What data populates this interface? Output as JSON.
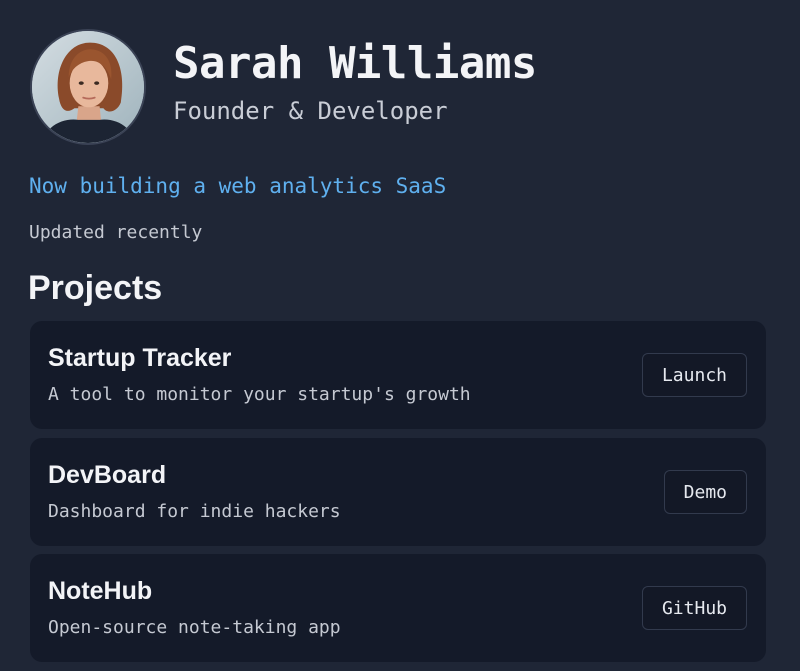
{
  "profile": {
    "name": "Sarah Williams",
    "role": "Founder & Developer",
    "avatar_icon": "profile-photo"
  },
  "status": {
    "text": "Now building a web analytics SaaS",
    "updated": "Updated recently",
    "color": "#5fb0ef"
  },
  "projects": {
    "heading": "Projects",
    "items": [
      {
        "title": "Startup Tracker",
        "description": "A tool to monitor your startup's growth",
        "button_label": "Launch"
      },
      {
        "title": "DevBoard",
        "description": "Dashboard for indie hackers",
        "button_label": "Demo"
      },
      {
        "title": "NoteHub",
        "description": "Open-source note-taking app",
        "button_label": "GitHub"
      }
    ]
  },
  "colors": {
    "background": "#1f2636",
    "card": "#141a29",
    "accent": "#5fb0ef"
  }
}
